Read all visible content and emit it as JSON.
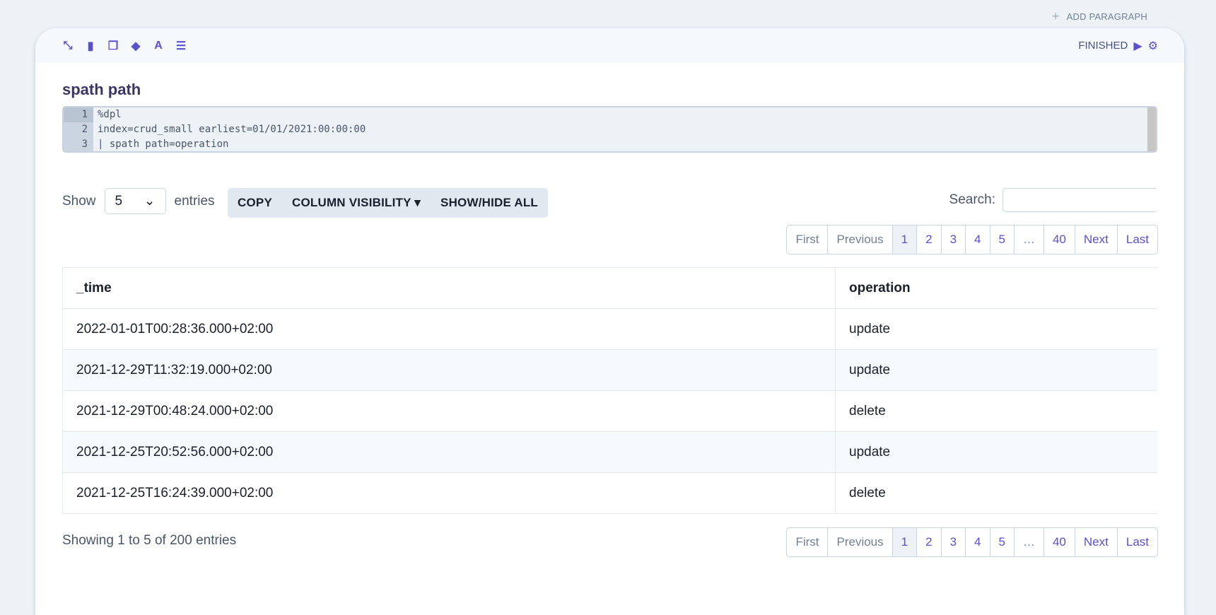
{
  "top": {
    "add_paragraph": "ADD PARAGRAPH"
  },
  "header": {
    "tools": [
      "compress-icon",
      "book-icon",
      "copy-icon",
      "eraser-icon",
      "font-icon",
      "list-ordered-icon"
    ],
    "status": "FINISHED"
  },
  "paragraph": {
    "title": "spath path",
    "code": [
      "%dpl",
      "index=crud_small earliest=01/01/2021:00:00:00",
      "| spath path=operation"
    ]
  },
  "controls": {
    "show": "Show",
    "entries_value": "5",
    "entries": "entries",
    "copy": "COPY",
    "column_visibility": "COLUMN VISIBILITY",
    "show_hide_all": "SHOW/HIDE ALL",
    "search_label": "Search:",
    "search_value": ""
  },
  "pagination": {
    "first": "First",
    "previous": "Previous",
    "pages": [
      "1",
      "2",
      "3",
      "4",
      "5",
      "…",
      "40"
    ],
    "next": "Next",
    "last": "Last",
    "active": "1"
  },
  "table": {
    "columns": [
      "_time",
      "operation"
    ],
    "rows": [
      [
        "2022-01-01T00:28:36.000+02:00",
        "update"
      ],
      [
        "2021-12-29T11:32:19.000+02:00",
        "update"
      ],
      [
        "2021-12-29T00:48:24.000+02:00",
        "delete"
      ],
      [
        "2021-12-25T20:52:56.000+02:00",
        "update"
      ],
      [
        "2021-12-25T16:24:39.000+02:00",
        "delete"
      ]
    ]
  },
  "info": "Showing 1 to 5 of 200 entries",
  "colors": {
    "accent": "#5a4fcf",
    "title": "#3b3566"
  }
}
